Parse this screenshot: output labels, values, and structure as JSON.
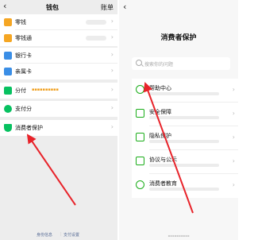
{
  "left": {
    "nav": {
      "back": "‹",
      "title": "钱包",
      "bill": "账单"
    },
    "items": [
      {
        "label": "零钱",
        "icon": "change-icon",
        "color": "#f5a623"
      },
      {
        "label": "零钱通",
        "icon": "change-pass-icon",
        "color": "#f5a623"
      },
      {
        "label": "银行卡",
        "icon": "bank-card-icon",
        "color": "#3a8ee6"
      },
      {
        "label": "亲属卡",
        "icon": "family-card-icon",
        "color": "#3a8ee6"
      },
      {
        "label": "分付",
        "icon": "fenfu-icon",
        "color": "#07c160"
      },
      {
        "label": "支付分",
        "icon": "payscore-icon",
        "color": "#07c160"
      },
      {
        "label": "消费者保护",
        "icon": "consumer-protection-icon",
        "color": "#07c160"
      }
    ],
    "footer": {
      "identity": "身份信息",
      "settings": "支付设置"
    }
  },
  "right": {
    "nav": {
      "back": "‹"
    },
    "title": "消费者保护",
    "search_placeholder": "搜索你的问题",
    "items": [
      {
        "label": "帮助中心",
        "icon": "help-icon"
      },
      {
        "label": "安全保障",
        "icon": "security-icon"
      },
      {
        "label": "隐私保护",
        "icon": "privacy-icon"
      },
      {
        "label": "协议与公示",
        "icon": "agreement-icon"
      },
      {
        "label": "消费者教育",
        "icon": "education-icon"
      }
    ]
  },
  "chevron": "›",
  "accent": "#e8232a"
}
